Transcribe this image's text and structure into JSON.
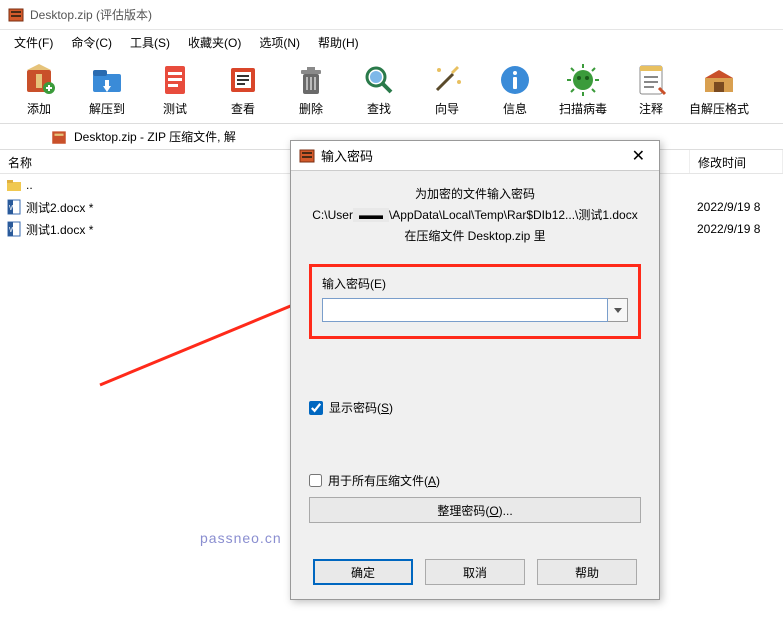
{
  "window": {
    "title": "Desktop.zip (评估版本)"
  },
  "menu": {
    "file": "文件(F)",
    "command": "命令(C)",
    "tools": "工具(S)",
    "favorites": "收藏夹(O)",
    "options": "选项(N)",
    "help": "帮助(H)"
  },
  "toolbar": {
    "add": "添加",
    "extract_to": "解压到",
    "test": "测试",
    "view": "查看",
    "delete": "删除",
    "find": "查找",
    "wizard": "向导",
    "info": "信息",
    "scan": "扫描病毒",
    "comment": "注释",
    "sfx": "自解压格式"
  },
  "pathbar": {
    "text": "Desktop.zip - ZIP 压缩文件, 解"
  },
  "columns": {
    "name": "名称",
    "modified": "修改时间"
  },
  "files": {
    "up": "..",
    "row1_name": "测试2.docx *",
    "row1_date": "2022/9/19 8",
    "row2_name": "测试1.docx *",
    "row2_date": "2022/9/19 8"
  },
  "dialog": {
    "title": "输入密码",
    "line1": "为加密的文件输入密码",
    "line2_prefix": "C:\\User",
    "line2_suffix": "\\AppData\\Local\\Temp\\Rar$DIb12...\\测试1.docx",
    "line3": "在压缩文件 Desktop.zip 里",
    "input_label": "输入密码(E)",
    "show_password": "显示密码(S)",
    "use_for_all": "用于所有压缩文件(A)",
    "manage": "整理密码(O)...",
    "ok": "确定",
    "cancel": "取消",
    "help": "帮助"
  },
  "watermark": "passneo.cn"
}
